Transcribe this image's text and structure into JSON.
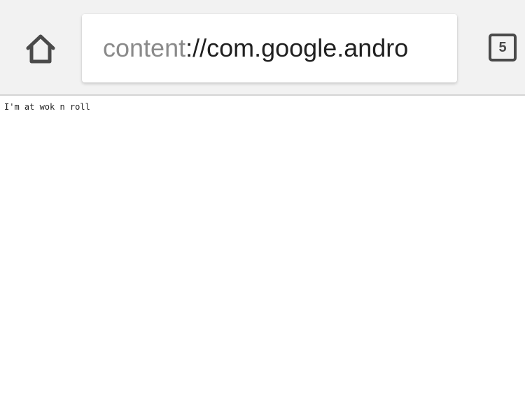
{
  "toolbar": {
    "home_icon": "home-icon",
    "url_scheme": "content",
    "url_rest": "://com.google.andro",
    "tab_count": "5"
  },
  "page": {
    "text": "I'm at wok n roll"
  }
}
